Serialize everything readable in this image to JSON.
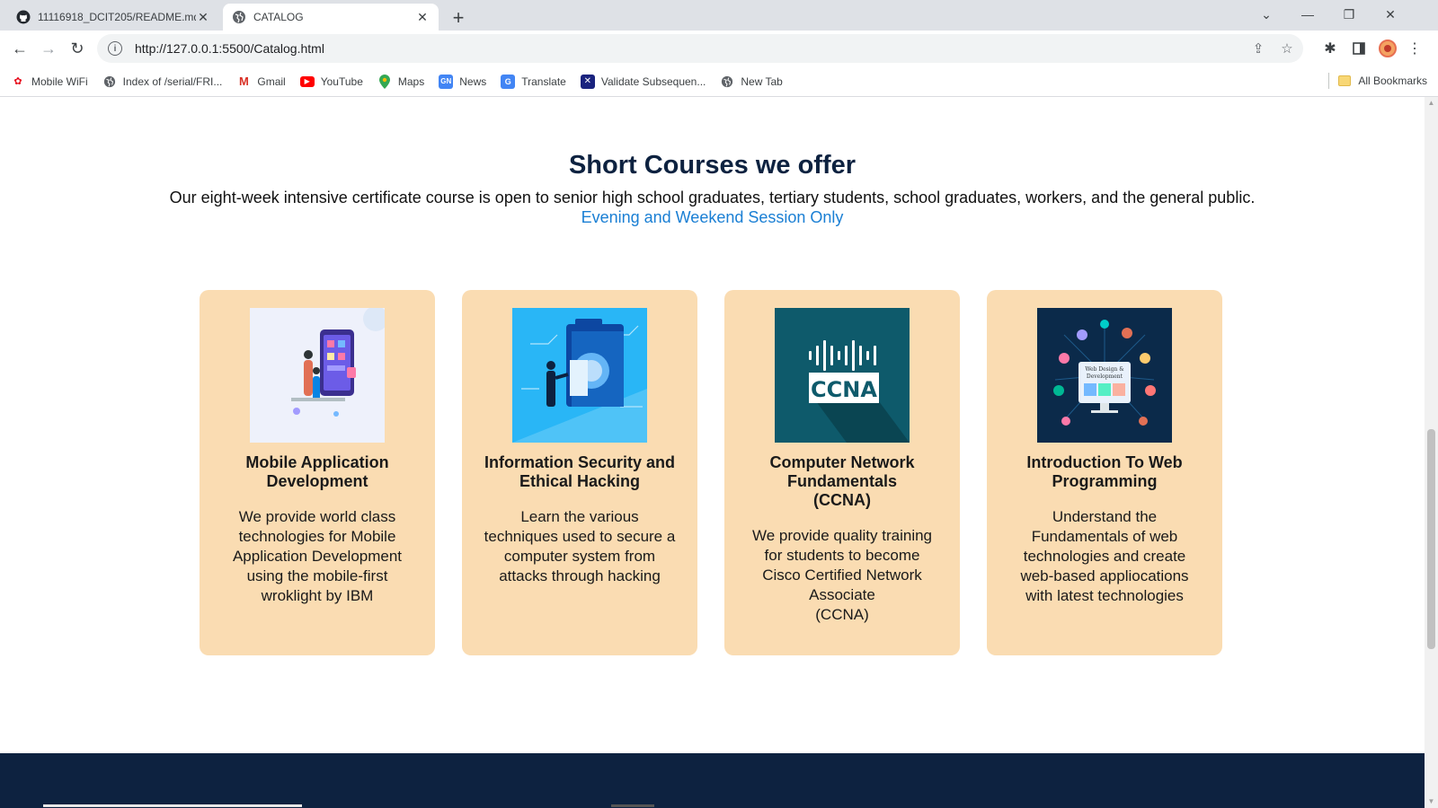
{
  "browser": {
    "tabs": [
      {
        "title": "11116918_DCIT205/README.md",
        "icon": "github-icon",
        "active": false
      },
      {
        "title": "CATALOG",
        "icon": "globe-icon",
        "active": true
      }
    ],
    "url": "http://127.0.0.1:5500/Catalog.html",
    "bookmarks": [
      {
        "label": "Mobile WiFi",
        "icon": "huawei-icon"
      },
      {
        "label": "Index of /serial/FRI...",
        "icon": "globe-icon"
      },
      {
        "label": "Gmail",
        "icon": "gmail-icon"
      },
      {
        "label": "YouTube",
        "icon": "youtube-icon"
      },
      {
        "label": "Maps",
        "icon": "maps-icon"
      },
      {
        "label": "News",
        "icon": "news-icon"
      },
      {
        "label": "Translate",
        "icon": "translate-icon"
      },
      {
        "label": "Validate Subsequen...",
        "icon": "validate-icon"
      },
      {
        "label": "New Tab",
        "icon": "globe-icon"
      }
    ],
    "all_bookmarks_label": "All Bookmarks"
  },
  "page": {
    "heading": "Short Courses we offer",
    "subtext": "Our eight-week intensive certificate course is open to senior high school graduates, tertiary students, school graduates, workers, and the general public.",
    "session": "Evening and Weekend Session Only",
    "colors": {
      "card_bg": "#fadcb2",
      "heading": "#0d2240",
      "session_link": "#1a7fd4",
      "footer": "#0d2240"
    },
    "courses": [
      {
        "title_lines": [
          "Mobile Application",
          "Development"
        ],
        "desc_lines": [
          "We provide world class",
          "technologies for Mobile",
          "Application Development",
          "using the mobile-first",
          "wroklight by IBM"
        ],
        "image": "mobile-app-illustration"
      },
      {
        "title_lines": [
          "Information Security and",
          "Ethical Hacking"
        ],
        "desc_lines": [
          "Learn the various",
          "techniques used to secure a",
          "computer system from",
          "attacks through hacking"
        ],
        "image": "security-illustration"
      },
      {
        "title_lines": [
          "Computer Network",
          "Fundamentals",
          "(CCNA)"
        ],
        "desc_lines": [
          "We provide quality training",
          "for students to become",
          "Cisco Certified Network",
          "Associate",
          "(CCNA)"
        ],
        "image": "ccna-logo",
        "image_text": "CCNA"
      },
      {
        "title_lines": [
          "Introduction To Web",
          "Programming"
        ],
        "desc_lines": [
          "Understand the",
          "Fundamentals of web",
          "technologies and create",
          "web-based appliocations",
          "with latest technologies"
        ],
        "image": "web-design-illustration",
        "image_text": [
          "Web Design &",
          "Development"
        ]
      }
    ]
  }
}
